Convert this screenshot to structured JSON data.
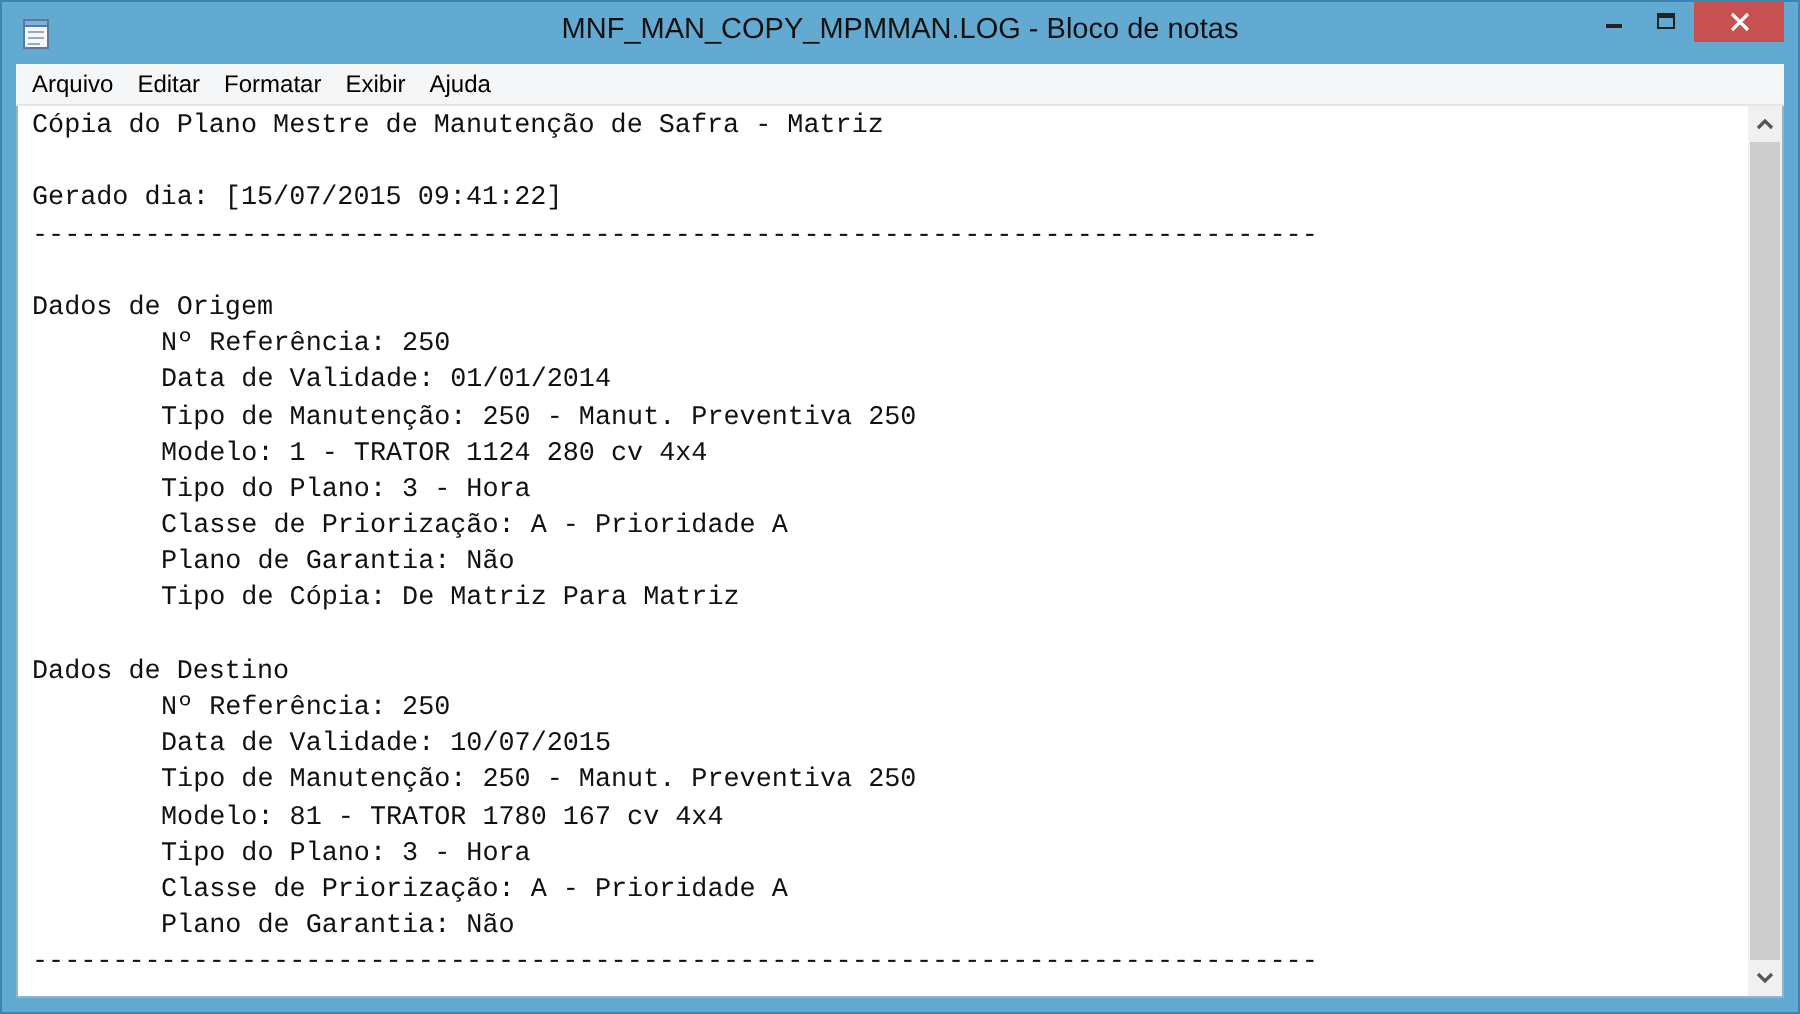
{
  "window": {
    "title": "MNF_MAN_COPY_MPMMAN.LOG - Bloco de notas"
  },
  "menu": [
    "Arquivo",
    "Editar",
    "Formatar",
    "Exibir",
    "Ajuda"
  ],
  "document": {
    "title": "Cópia do Plano Mestre de Manutenção de Safra - Matriz",
    "generated": "Gerado dia: [15/07/2015 09:41:22]",
    "rule": "--------------------------------------------------------------------------------",
    "sections": [
      {
        "heading": "Dados de Origem",
        "fields": [
          "Nº Referência: 250",
          "Data de Validade: 01/01/2014",
          "Tipo de Manutenção: 250 - Manut. Preventiva 250",
          "Modelo: 1 - TRATOR 1124 280 cv 4x4",
          "Tipo do Plano: 3 - Hora",
          "Classe de Priorização: A - Prioridade A",
          "Plano de Garantia: Não",
          "Tipo de Cópia: De Matriz Para Matriz"
        ]
      },
      {
        "heading": "Dados de Destino",
        "fields": [
          "Nº Referência: 250",
          "Data de Validade: 10/07/2015",
          "Tipo de Manutenção: 250 - Manut. Preventiva 250",
          "Modelo: 81 - TRATOR 1780 167 cv 4x4",
          "Tipo do Plano: 3 - Hora",
          "Classe de Priorização: A - Prioridade A",
          "Plano de Garantia: Não"
        ]
      }
    ],
    "closing_rule": "--------------------------------------------------------------------------------"
  }
}
